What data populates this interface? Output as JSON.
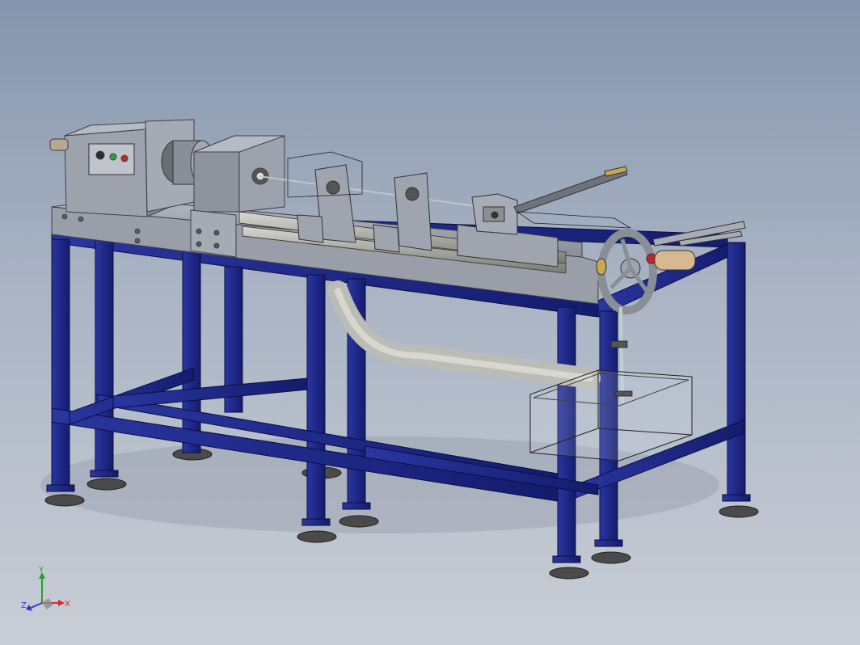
{
  "viewport": {
    "background_top": "#8695ad",
    "background_bottom": "#c9ced6",
    "frame_color": "#1f2a8a",
    "frame_dark": "#0f1660",
    "machine_gray": "#9a9ea8",
    "machine_dark": "#6e727c",
    "pipe_color": "#c8c8c4"
  },
  "triad": {
    "x_label": "X",
    "y_label": "Y",
    "z_label": "Z",
    "x_color": "#d42a2a",
    "y_color": "#2aa02a",
    "z_color": "#2a3ad4"
  }
}
